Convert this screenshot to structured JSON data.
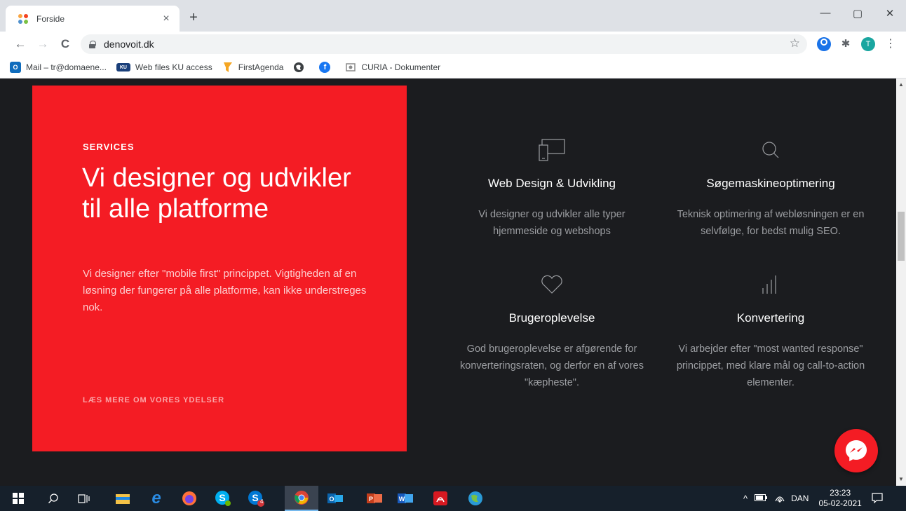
{
  "browser": {
    "tab": {
      "title": "Forside",
      "close": "×"
    },
    "new_tab": "+",
    "window_controls": {
      "minimize": "—",
      "maximize": "▢",
      "close": "✕"
    },
    "nav": {
      "back": "←",
      "forward": "→",
      "reload": "C"
    },
    "url": "denovoit.dk",
    "star": "☆",
    "profile_initial": "T",
    "menu": "⋮"
  },
  "bookmarks": [
    {
      "label": "Mail – tr@domaene...",
      "icon": "outlook-icon",
      "color": "#0f6cbd"
    },
    {
      "label": "Web files KU access",
      "icon": "ku-icon",
      "color": "#1a3f7a"
    },
    {
      "label": "FirstAgenda",
      "icon": "firstagenda-icon",
      "color": "#f5a623"
    },
    {
      "label": "",
      "icon": "globe-icon",
      "color": "#3c4043"
    },
    {
      "label": "",
      "icon": "facebook-icon",
      "color": "#1877f2"
    },
    {
      "label": "CURIA - Dokumenter",
      "icon": "curia-icon",
      "color": "#8a8a8a"
    }
  ],
  "hero": {
    "eyebrow": "SERVICES",
    "headline": "Vi designer og udvikler til alle platforme",
    "lead": "Vi designer efter \"mobile first\" princippet. Vigtigheden af en løsning der fungerer på alle platforme, kan ikke understreges nok.",
    "link": "LÆS MERE OM VORES YDELSER"
  },
  "services": [
    {
      "title": "Web Design & Udvikling",
      "text": "Vi designer og udvikler alle typer hjemmeside og webshops"
    },
    {
      "title": "Søgemaskineoptimering",
      "text": "Teknisk optimering af webløsningen er en selvfølge, for bedst mulig SEO."
    },
    {
      "title": "Brugeroplevelse",
      "text": "God brugeroplevelse er afgørende for konverteringsraten, og derfor en af vores \"kæpheste\"."
    },
    {
      "title": "Konvertering",
      "text": "Vi arbejder efter \"most wanted response\" princippet, med klare mål og call-to-action elementer."
    }
  ],
  "colors": {
    "accent": "#f41c24",
    "background": "#1b1c1f"
  },
  "taskbar": {
    "skype_badge": "4",
    "language": "DAN",
    "time": "23:23",
    "date": "05-02-2021"
  }
}
